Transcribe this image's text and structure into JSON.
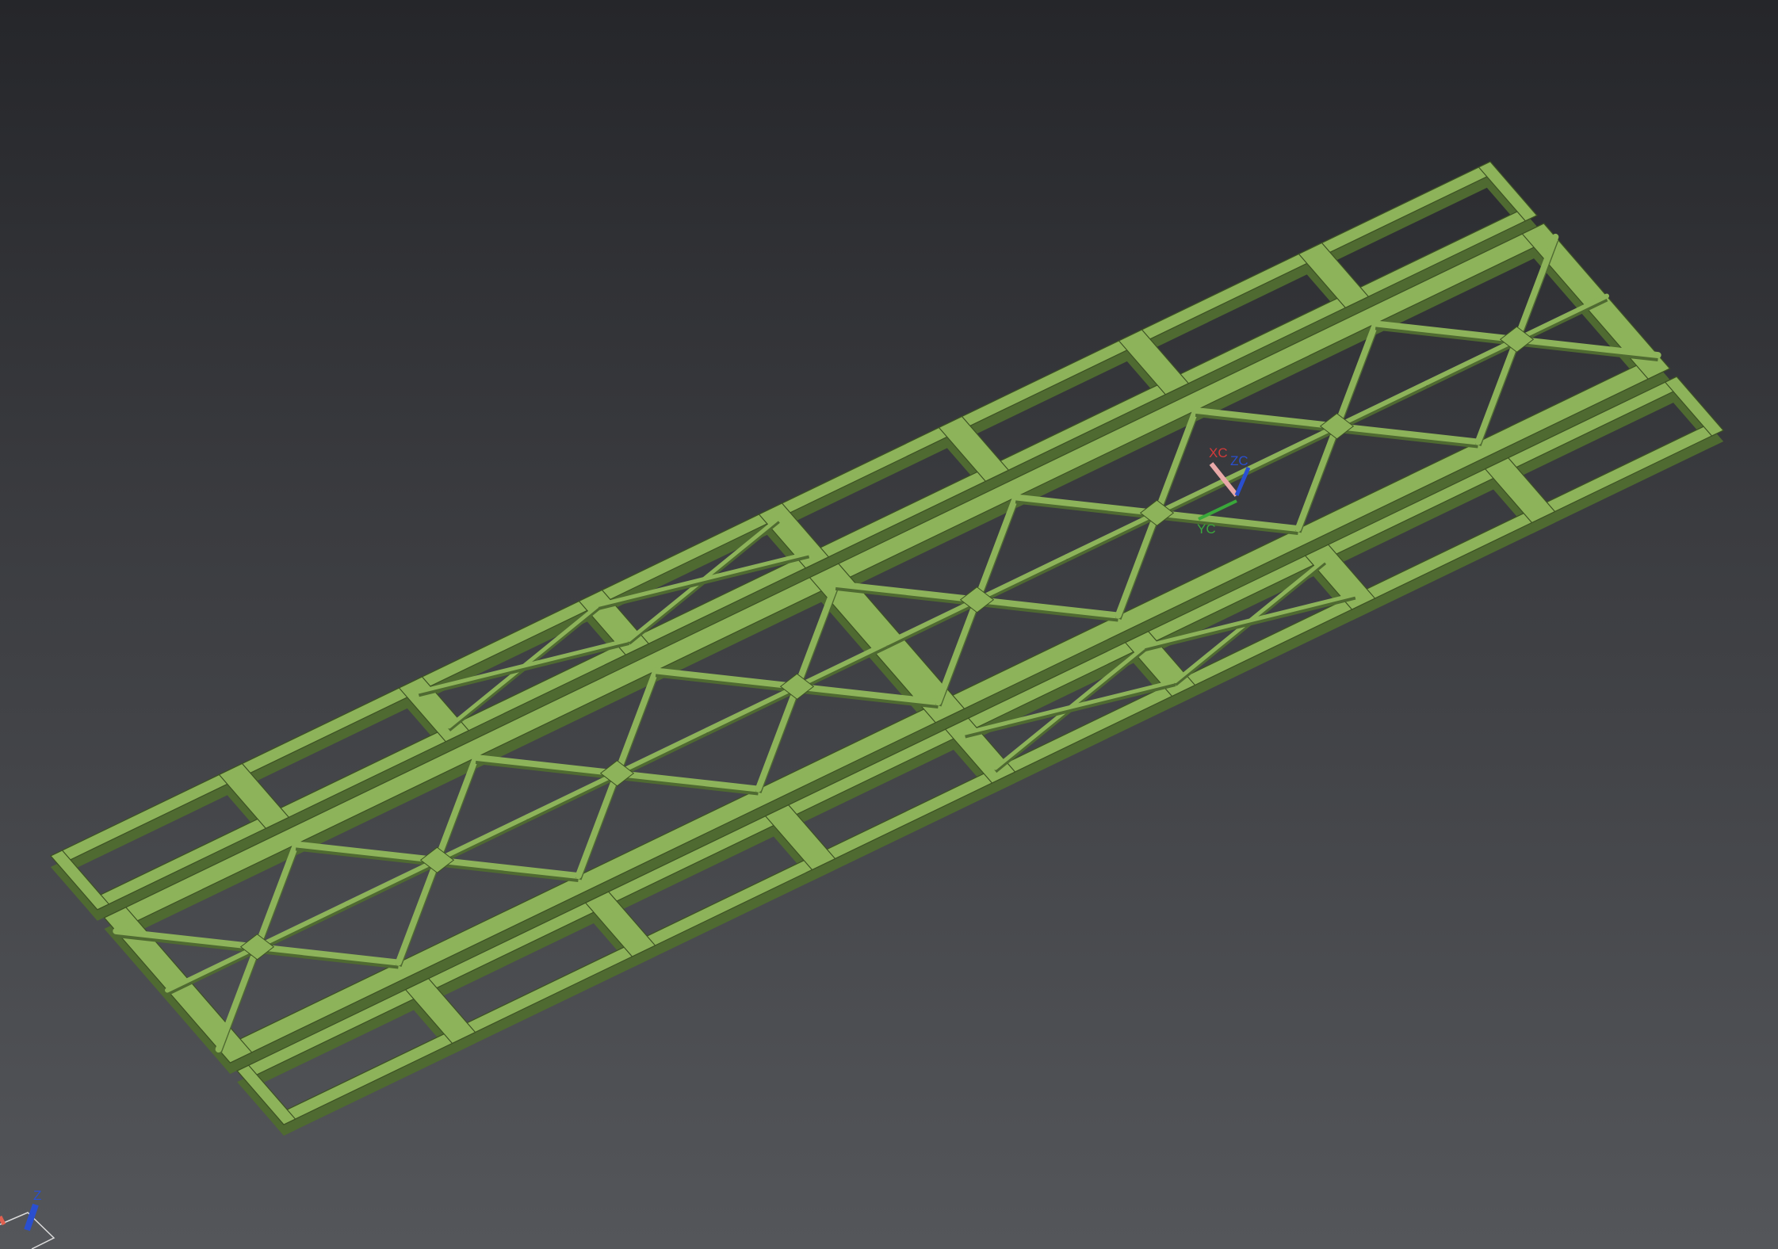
{
  "viewport": {
    "model": "truss-frame-assembly",
    "body_color": "#8db35a",
    "edge_color": "#3d5224",
    "side_color": "#4f6a31"
  },
  "wcs_triad": {
    "x_label": "XC",
    "y_label": "YC",
    "z_label": "ZC",
    "x_color": "#d23a3a",
    "y_color": "#3aa83a",
    "z_color": "#2a4fd0"
  },
  "view_triad": {
    "z_label": "Z",
    "z_color": "#2a4fd0"
  }
}
